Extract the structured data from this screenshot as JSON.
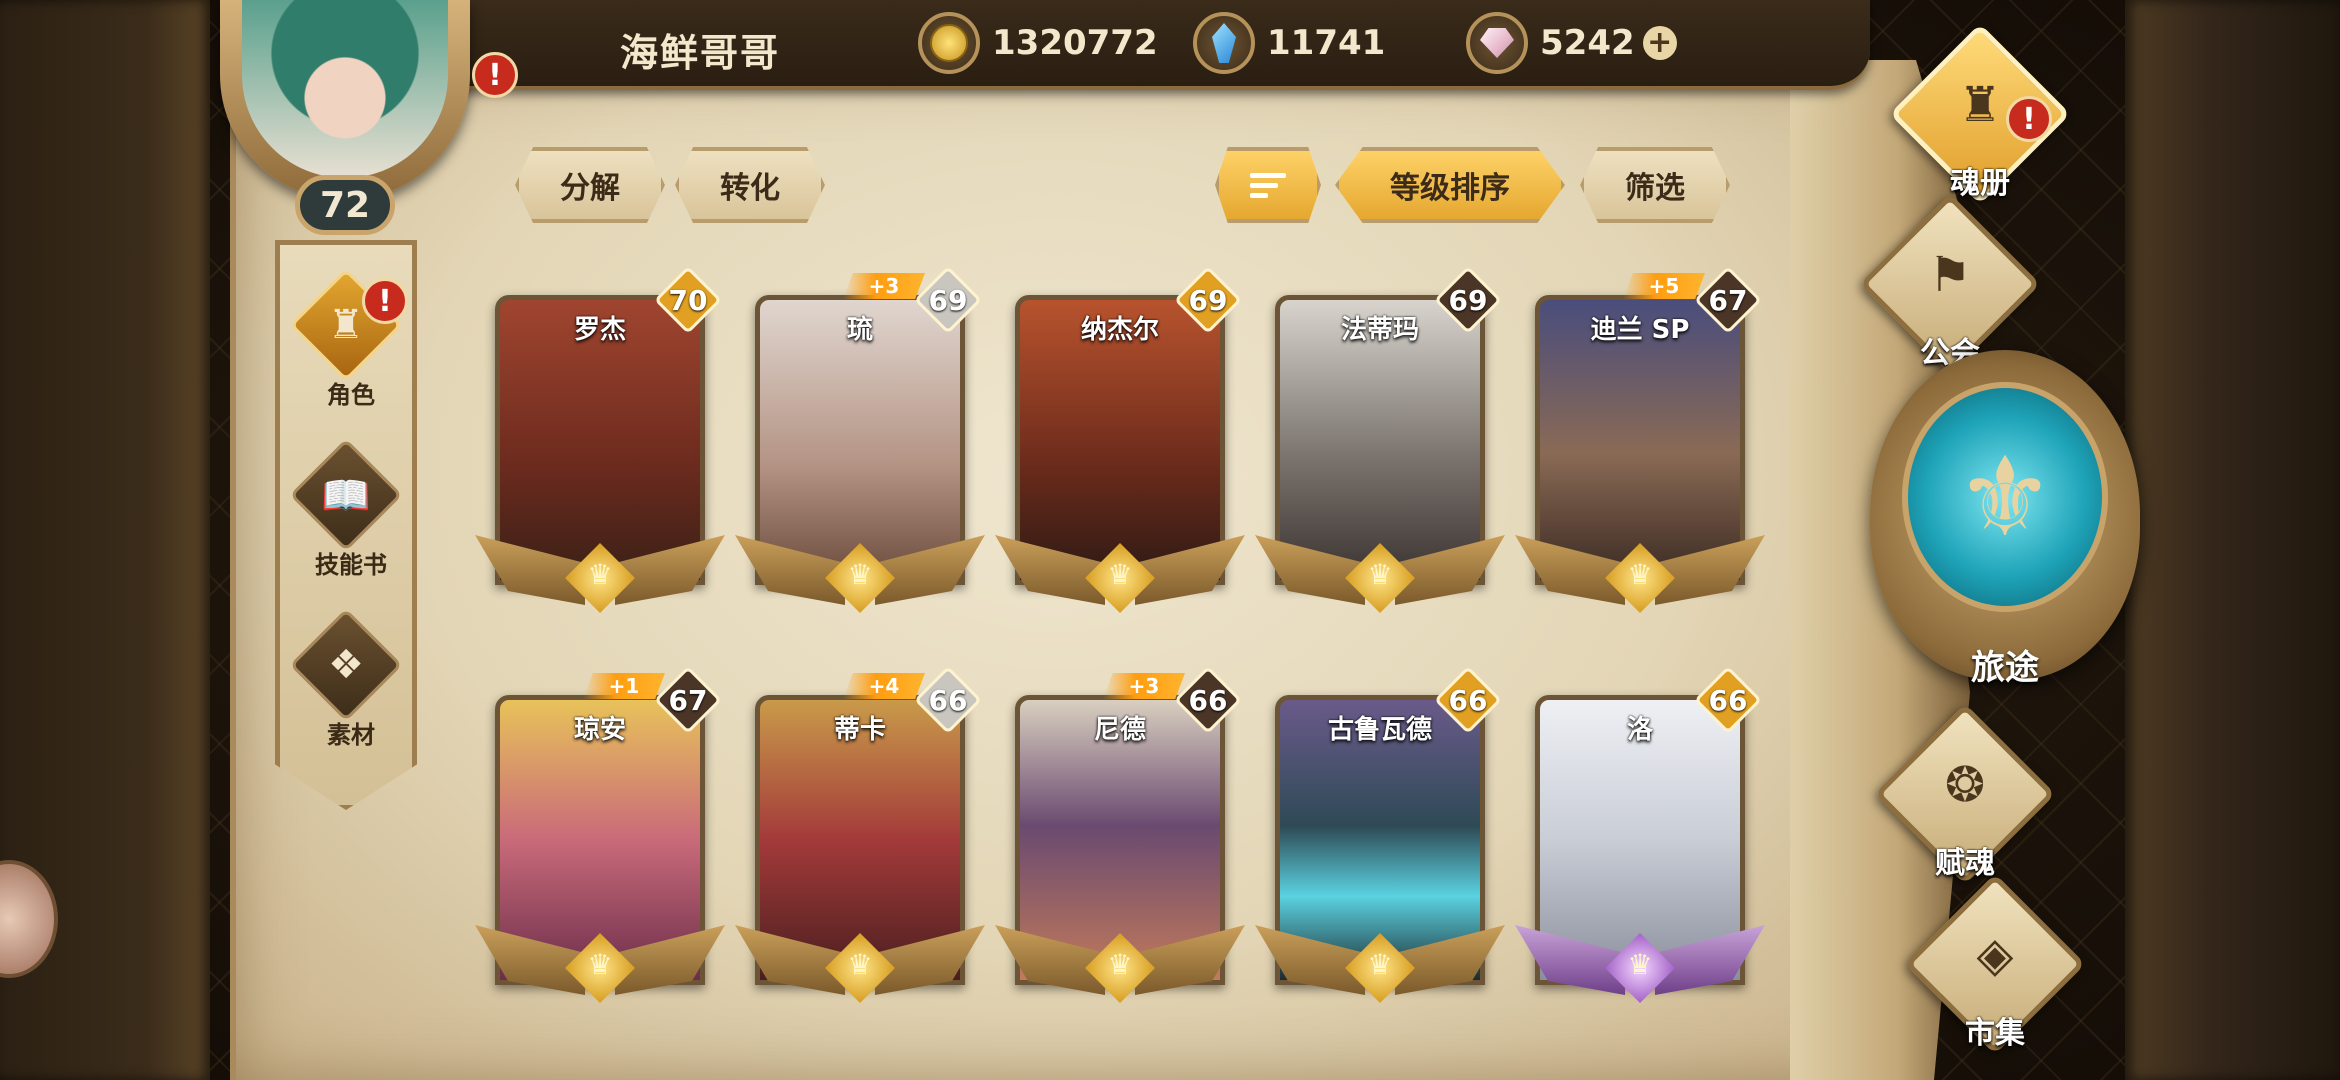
{
  "player": {
    "name": "海鲜哥哥",
    "level": "72",
    "alert": "!"
  },
  "currencies": [
    {
      "icon": "gold-coin-icon",
      "value": "1320772"
    },
    {
      "icon": "blue-crystal-icon",
      "value": "11741"
    },
    {
      "icon": "pink-gem-icon",
      "value": "5242",
      "add": "+"
    }
  ],
  "left_nav": [
    {
      "label": "角色",
      "icon": "helmet-icon",
      "active": true,
      "alert": "!"
    },
    {
      "label": "技能书",
      "icon": "spellbook-icon",
      "active": false
    },
    {
      "label": "素材",
      "icon": "material-icon",
      "active": false
    }
  ],
  "actions": {
    "decompose": "分解",
    "convert": "转化",
    "sort_by_level": "等级排序",
    "filter": "筛选"
  },
  "heroes": [
    {
      "name": "罗杰",
      "level": "70",
      "plus": "",
      "level_color": "#e1a021",
      "art": "#8a3a2a",
      "frame": "gold"
    },
    {
      "name": "琉",
      "level": "69",
      "plus": "+3",
      "level_color": "#c9c6bf",
      "art": "#c3a79a",
      "frame": "gold"
    },
    {
      "name": "纳杰尔",
      "level": "69",
      "plus": "",
      "level_color": "#e1a021",
      "art": "#8a3a22",
      "frame": "gold"
    },
    {
      "name": "法蒂玛",
      "level": "69",
      "plus": "",
      "level_color": "#4a3526",
      "art": "#6f6a66",
      "frame": "gold"
    },
    {
      "name": "迪兰 SP",
      "level": "67",
      "plus": "+5",
      "level_color": "#4a3526",
      "art": "#3c3f63",
      "frame": "gold"
    },
    {
      "name": "琼安",
      "level": "67",
      "plus": "+1",
      "level_color": "#4a3526",
      "art": "#b04a5a",
      "frame": "gold"
    },
    {
      "name": "蒂卡",
      "level": "66",
      "plus": "+4",
      "level_color": "#c9c6bf",
      "art": "#7a2a2a",
      "frame": "gold"
    },
    {
      "name": "尼德",
      "level": "66",
      "plus": "+3",
      "level_color": "#4a3526",
      "art": "#4e3a56",
      "frame": "gold"
    },
    {
      "name": "古鲁瓦德",
      "level": "66",
      "plus": "",
      "level_color": "#e1a021",
      "art": "#2e4a56",
      "frame": "gold"
    },
    {
      "name": "洛",
      "level": "66",
      "plus": "",
      "level_color": "#e1a021",
      "art": "#c9cdd6",
      "frame": "purple"
    }
  ],
  "right_menu": [
    {
      "label": "魂册",
      "icon": "soul-book-icon",
      "active": true,
      "alert": "!"
    },
    {
      "label": "公会",
      "icon": "guild-banner-icon",
      "active": false
    },
    {
      "label": "旅途",
      "icon": "journey-emblem-icon",
      "active": false
    },
    {
      "label": "赋魂",
      "icon": "soul-flame-icon",
      "active": false
    },
    {
      "label": "市集",
      "icon": "market-gem-icon",
      "active": false
    }
  ]
}
